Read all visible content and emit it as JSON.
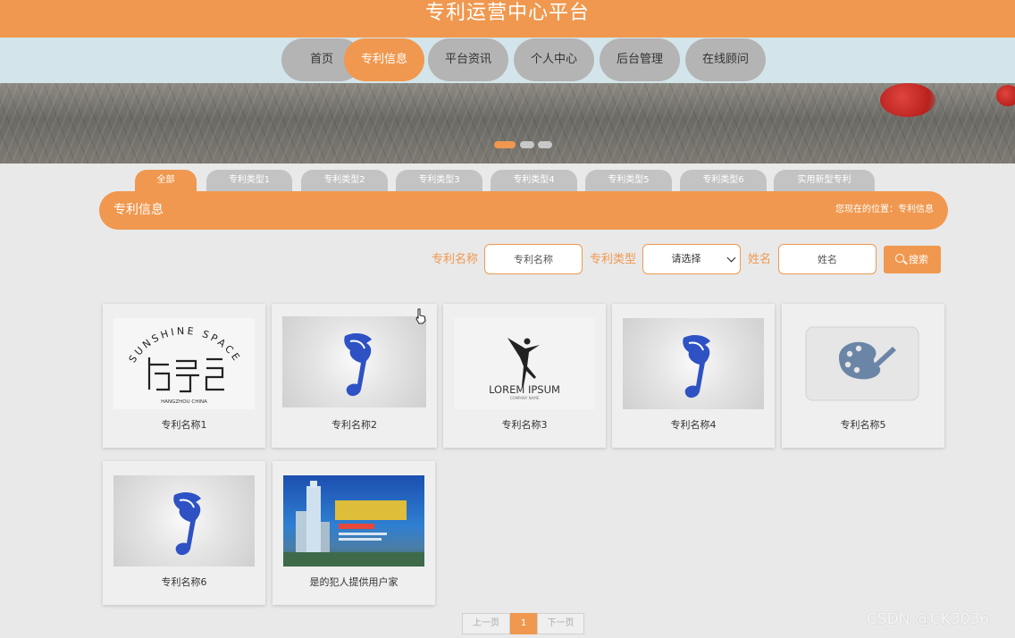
{
  "header": {
    "title": "专利运营中心平台"
  },
  "nav": {
    "items": [
      {
        "label": "首页"
      },
      {
        "label": "专利信息",
        "active": true
      },
      {
        "label": "平台资讯"
      },
      {
        "label": "个人中心"
      },
      {
        "label": "后台管理"
      },
      {
        "label": "在线顾问"
      }
    ]
  },
  "carousel": {
    "slide_count": 3,
    "active_index": 0
  },
  "categories": [
    {
      "label": "全部",
      "active": true
    },
    {
      "label": "专利类型1"
    },
    {
      "label": "专利类型2"
    },
    {
      "label": "专利类型3"
    },
    {
      "label": "专利类型4"
    },
    {
      "label": "专利类型5"
    },
    {
      "label": "专利类型6"
    },
    {
      "label": "实用新型专利"
    }
  ],
  "section": {
    "title": "专利信息",
    "breadcrumb": "您现在的位置：专利信息"
  },
  "search": {
    "name_label": "专利名称",
    "name_placeholder": "专利名称",
    "type_label": "专利类型",
    "type_selected": "请选择",
    "person_label": "姓名",
    "person_placeholder": "姓名",
    "button_label": "搜索"
  },
  "cards": [
    {
      "name": "专利名称1",
      "image": "sunshine-space-logo",
      "logo_text": "SUNSHINE SPACE",
      "logo_sub": "HANGZHOU CHINA"
    },
    {
      "name": "专利名称2",
      "image": "music-note-logo"
    },
    {
      "name": "专利名称3",
      "image": "dancer-logo",
      "logo_text": "LOREM IPSUM",
      "logo_sub": "COMPANY NAME"
    },
    {
      "name": "专利名称4",
      "image": "music-note-logo"
    },
    {
      "name": "专利名称5",
      "image": "palette-icon"
    },
    {
      "name": "专利名称6",
      "image": "music-note-logo"
    },
    {
      "name": "是的犯人提供用户家",
      "image": "city-poster"
    }
  ],
  "pagination": {
    "prev": "上一页",
    "current": "1",
    "next": "下一页"
  },
  "watermark": "CSDN @CK3036",
  "colors": {
    "accent": "#f0984f",
    "nav_bg": "#d3e5ea",
    "page_bg": "#e9e9e9",
    "inactive_pill": "#b4b4b4",
    "note_blue": "#2e52c4"
  }
}
